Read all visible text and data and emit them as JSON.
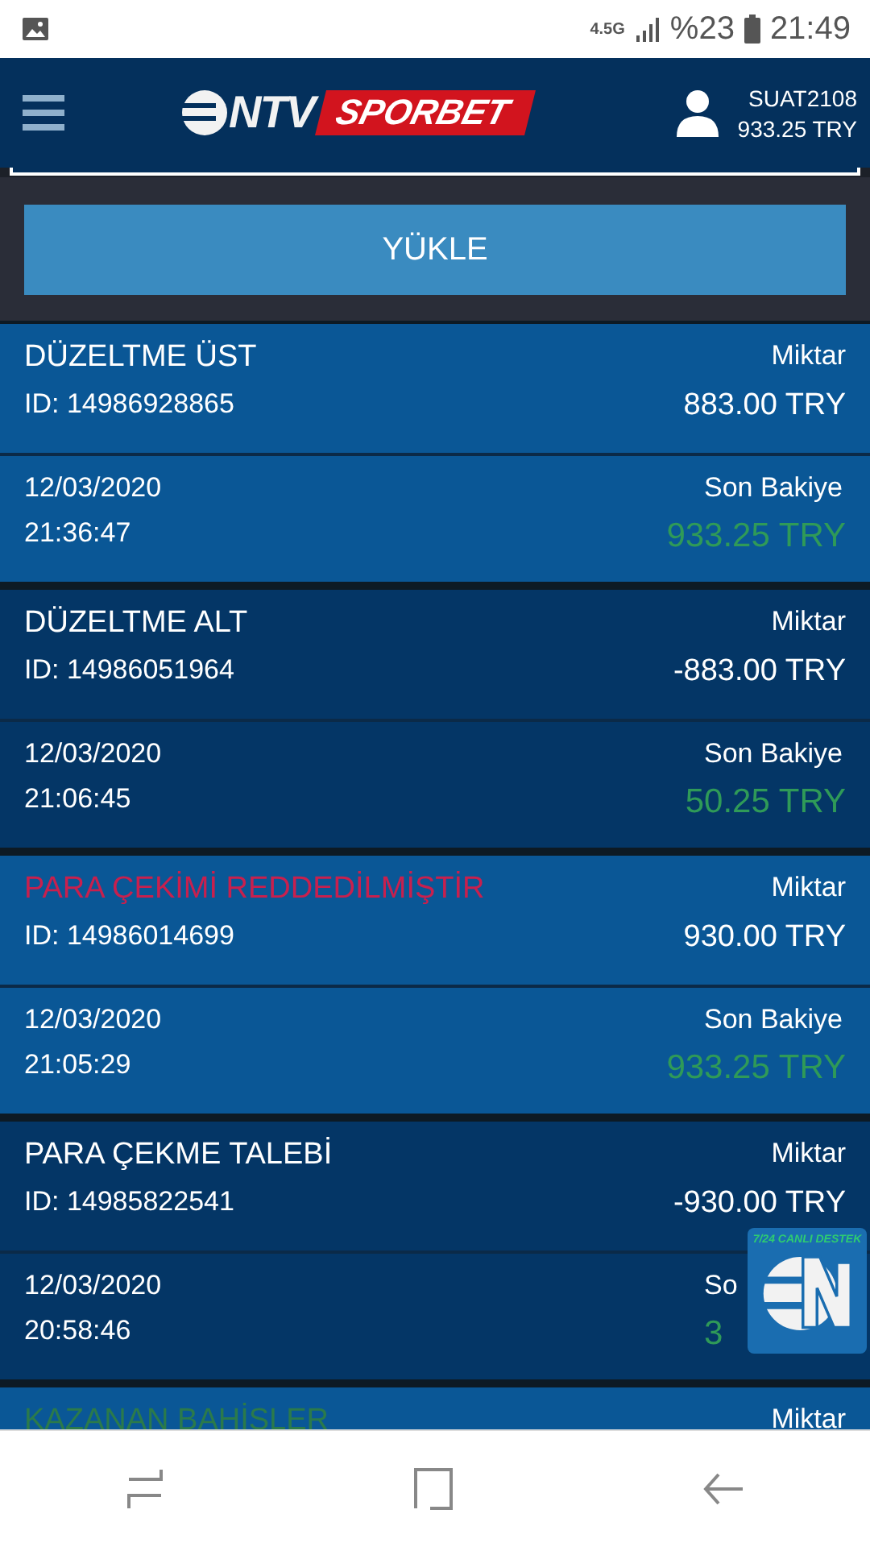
{
  "status_bar": {
    "network": "4.5G",
    "battery": "%23",
    "time": "21:49"
  },
  "header": {
    "logo_left": "NTV",
    "logo_right": "SPORBET",
    "username": "SUAT2108",
    "balance": "933.25 TRY"
  },
  "load_button": "YÜKLE",
  "transactions": [
    {
      "title": "DÜZELTME ÜST",
      "color": "#ffffff",
      "amount_label": "Miktar",
      "id": "ID: 14986928865",
      "amount": "883.00 TRY",
      "date": "12/03/2020",
      "time": "21:36:47",
      "balance_label": "Son Bakiye",
      "balance": "933.25 TRY"
    },
    {
      "title": "DÜZELTME ALT",
      "color": "#ffffff",
      "amount_label": "Miktar",
      "id": "ID: 14986051964",
      "amount": "-883.00 TRY",
      "date": "12/03/2020",
      "time": "21:06:45",
      "balance_label": "Son Bakiye",
      "balance": "50.25 TRY"
    },
    {
      "title": "PARA ÇEKİMİ REDDEDİLMİŞTİR",
      "color": "#c8204e",
      "amount_label": "Miktar",
      "id": "ID: 14986014699",
      "amount": "930.00 TRY",
      "date": "12/03/2020",
      "time": "21:05:29",
      "balance_label": "Son Bakiye",
      "balance": "933.25 TRY"
    },
    {
      "title": "PARA ÇEKME TALEBİ",
      "color": "#ffffff",
      "amount_label": "Miktar",
      "id": "ID: 14985822541",
      "amount": "-930.00 TRY",
      "date": "12/03/2020",
      "time": "20:58:46",
      "balance_label": "So",
      "balance": "3"
    },
    {
      "title": "KAZANAN BAHİSLER",
      "color": "#2b7a4b",
      "amount_label": "Miktar"
    }
  ],
  "chat_widget": {
    "caption": "7/24 CANLI DESTEK"
  }
}
